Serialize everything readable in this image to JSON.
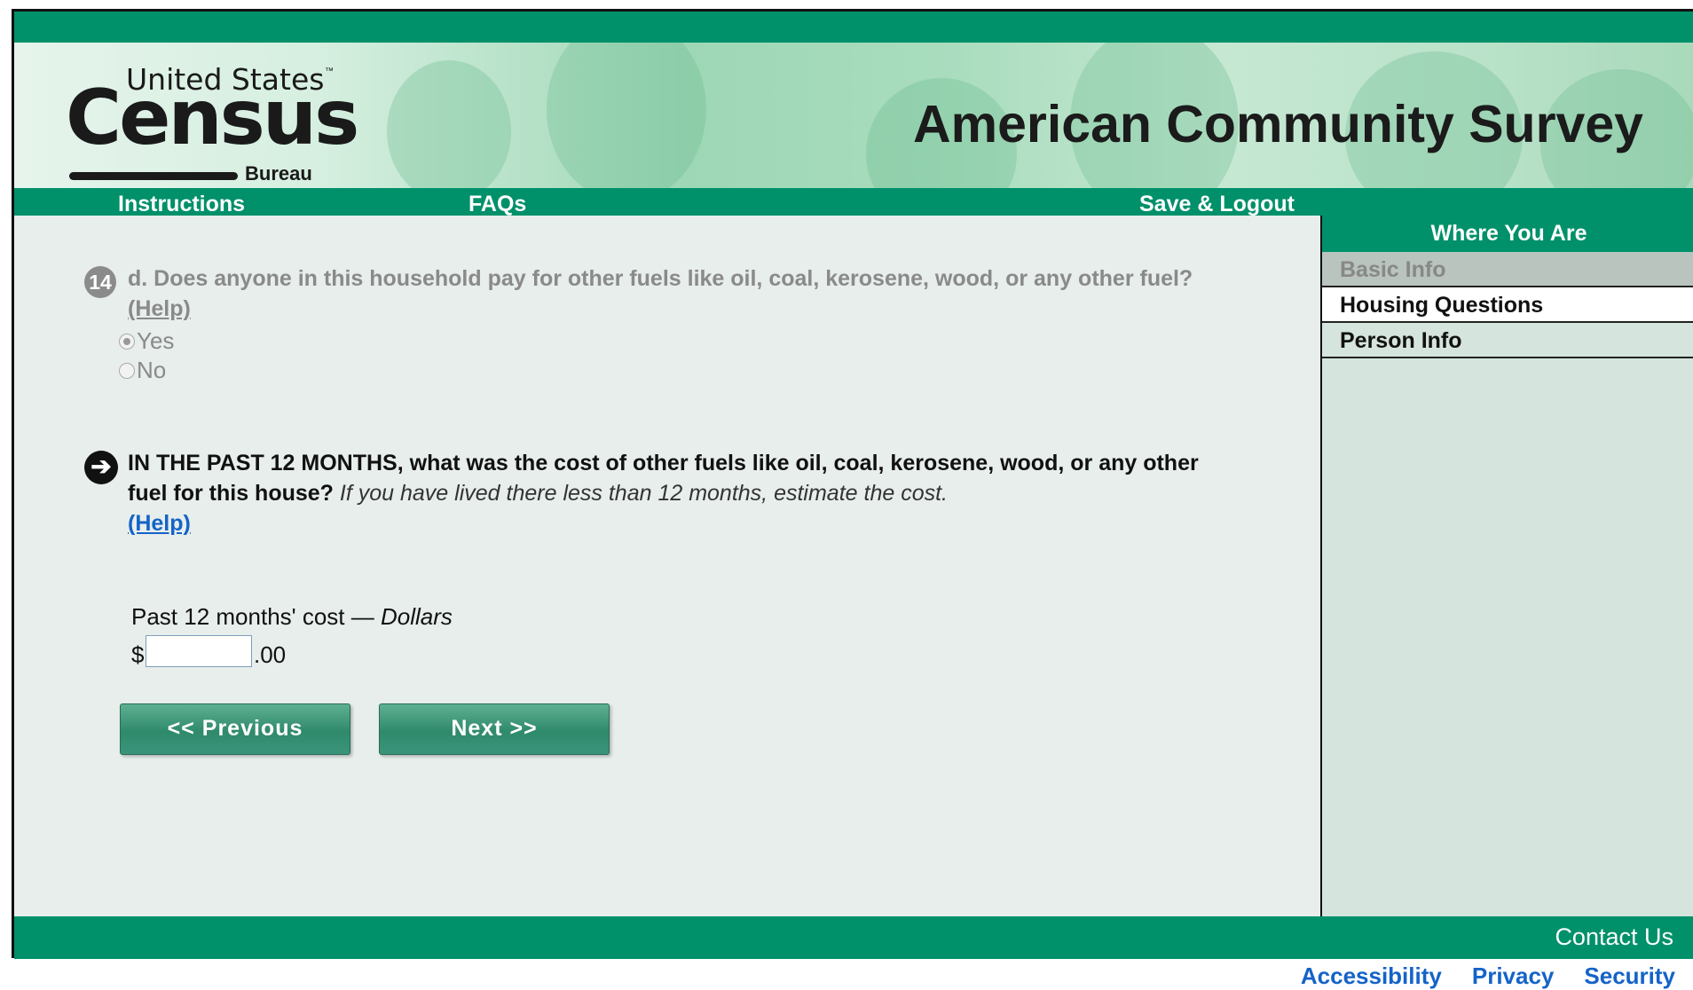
{
  "header": {
    "logo": {
      "line1": "United States",
      "tm": "™",
      "main": "Census",
      "sub": "Bureau"
    },
    "title": "American Community Survey"
  },
  "nav": {
    "instructions": "Instructions",
    "faqs": "FAQs",
    "save_logout": "Save & Logout"
  },
  "sidebar": {
    "heading": "Where You Are",
    "items": [
      {
        "label": "Basic Info",
        "state": "done"
      },
      {
        "label": "Housing Questions",
        "state": "current"
      },
      {
        "label": "Person Info",
        "state": "upcoming"
      }
    ]
  },
  "previous_question": {
    "number": "14",
    "text": "d. Does anyone in this household pay for other fuels like oil, coal, kerosene, wood, or any other fuel?",
    "help": "(Help)",
    "options": [
      {
        "label": "Yes",
        "selected": true
      },
      {
        "label": "No",
        "selected": false
      }
    ]
  },
  "current_question": {
    "arrow": "➔",
    "text_bold": "IN THE PAST 12 MONTHS, what was the cost of other fuels like oil, coal, kerosene, wood, or any other fuel for this house?",
    "hint": "If you have lived there less than 12 months, estimate the cost.",
    "help": "(Help)",
    "cost_label": "Past 12 months' cost — ",
    "cost_unit": "Dollars",
    "currency": "$",
    "value": "",
    "cents": ".00"
  },
  "buttons": {
    "previous": "<<   Previous",
    "next": "Next   >>"
  },
  "footer": {
    "contact": "Contact Us",
    "links": [
      "Accessibility",
      "Privacy",
      "Security"
    ]
  },
  "colors": {
    "brand_green": "#00906a",
    "link_blue": "#1463c8",
    "content_bg": "#e7eeeb"
  }
}
